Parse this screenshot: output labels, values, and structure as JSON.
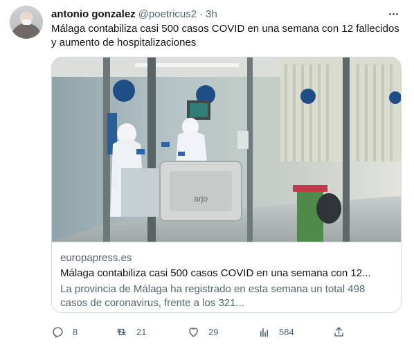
{
  "tweet": {
    "author_name": "antonio gonzalez",
    "author_handle": "@poetricus2",
    "separator": "·",
    "time": "3h",
    "text": "Málaga contabiliza casi 500 casos COVID en una semana con 12 fallecidos y aumento de hospitalizaciones"
  },
  "card": {
    "domain": "europapress.es",
    "title": "Málaga contabiliza casi 500 casos COVID en una semana con 12...",
    "description": "La provincia de Málaga ha registrado en esta semana un total 498 casos de coronavirus, frente a los 321...",
    "image_bed_label": "arjo"
  },
  "actions": {
    "replies": "8",
    "retweets": "21",
    "likes": "29",
    "views": "584"
  },
  "icons": {
    "more": "more-dots-icon",
    "reply": "reply-icon",
    "retweet": "retweet-icon",
    "like": "heart-icon",
    "views": "views-chart-icon",
    "share": "share-icon"
  },
  "colors": {
    "text_primary": "#0f1419",
    "text_secondary": "#536471",
    "border": "#cfd9de",
    "background": "#ffffff"
  }
}
